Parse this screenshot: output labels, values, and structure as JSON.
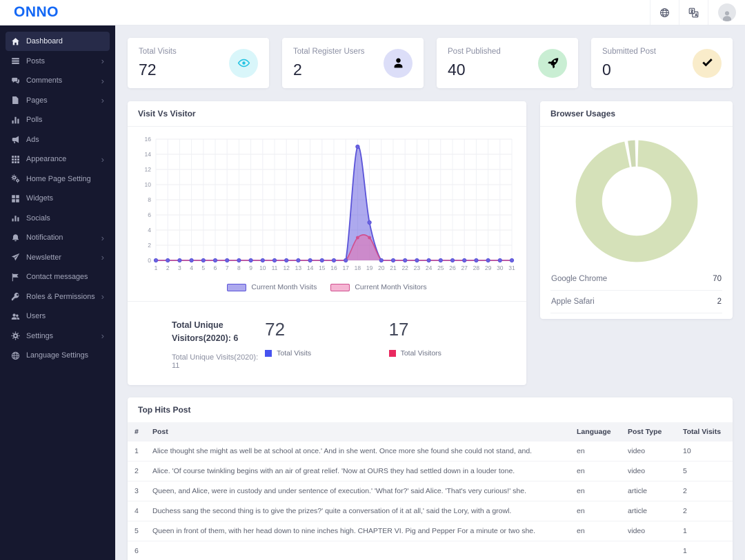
{
  "app": {
    "brand": "ONNO",
    "brand_color": "#1468f5"
  },
  "header": {
    "actions": [
      {
        "icon": "globe",
        "name": "language-button"
      },
      {
        "icon": "translate",
        "name": "translate-button"
      },
      {
        "icon": "avatar",
        "name": "profile-avatar"
      }
    ]
  },
  "sidebar": {
    "items": [
      {
        "label": "Dashboard",
        "icon": "home",
        "active": true,
        "has_submenu": false
      },
      {
        "label": "Posts",
        "icon": "posts",
        "active": false,
        "has_submenu": true
      },
      {
        "label": "Comments",
        "icon": "comments",
        "active": false,
        "has_submenu": true
      },
      {
        "label": "Pages",
        "icon": "pages",
        "active": false,
        "has_submenu": true
      },
      {
        "label": "Polls",
        "icon": "polls",
        "active": false,
        "has_submenu": false
      },
      {
        "label": "Ads",
        "icon": "ads",
        "active": false,
        "has_submenu": false
      },
      {
        "label": "Appearance",
        "icon": "appearance",
        "active": false,
        "has_submenu": true
      },
      {
        "label": "Home Page Setting",
        "icon": "home-page-setting",
        "active": false,
        "has_submenu": false
      },
      {
        "label": "Widgets",
        "icon": "widgets",
        "active": false,
        "has_submenu": false
      },
      {
        "label": "Socials",
        "icon": "socials",
        "active": false,
        "has_submenu": false
      },
      {
        "label": "Notification",
        "icon": "notification",
        "active": false,
        "has_submenu": true
      },
      {
        "label": "Newsletter",
        "icon": "newsletter",
        "active": false,
        "has_submenu": true
      },
      {
        "label": "Contact messages",
        "icon": "contact-messages",
        "active": false,
        "has_submenu": false
      },
      {
        "label": "Roles & Permissions",
        "icon": "roles-permissions",
        "active": false,
        "has_submenu": true
      },
      {
        "label": "Users",
        "icon": "users",
        "active": false,
        "has_submenu": false
      },
      {
        "label": "Settings",
        "icon": "settings",
        "active": false,
        "has_submenu": true
      },
      {
        "label": "Language Settings",
        "icon": "language-settings",
        "active": false,
        "has_submenu": false
      }
    ]
  },
  "stat_cards": [
    {
      "label": "Total Visits",
      "value": "72",
      "icon": "eye",
      "icon_color": "#23c3e2",
      "icon_bg": "#d9f6fa"
    },
    {
      "label": "Total Register Users",
      "value": "2",
      "icon": "user",
      "icon_color": "#5a63d8",
      "icon_bg": "#dcdef8"
    },
    {
      "label": "Post Published",
      "value": "40",
      "icon": "rocket",
      "icon_color": "#2ebd59",
      "icon_bg": "#c9eed3"
    },
    {
      "label": "Submitted Post",
      "value": "0",
      "icon": "check",
      "icon_color": "#f0b93c",
      "icon_bg": "#f9ecca"
    }
  ],
  "visit_card": {
    "title": "Visit Vs Visitor",
    "summary": {
      "unique_visitors": "Total Unique Visitors(2020): 6",
      "unique_visits": "Total Unique Visits(2020): 11",
      "visits": {
        "value": "72",
        "label": "Total Visits",
        "color": "#4653ef"
      },
      "visitors": {
        "value": "17",
        "label": "Total Visitors",
        "color": "#e9295f"
      }
    }
  },
  "browser_card": {
    "title": "Browser Usages",
    "rows": [
      {
        "label": "Google Chrome",
        "value": "70"
      },
      {
        "label": "Apple Safari",
        "value": "2"
      }
    ]
  },
  "top_hits": {
    "title": "Top Hits Post",
    "columns": [
      "#",
      "Post",
      "Language",
      "Post Type",
      "Total Visits"
    ],
    "rows": [
      {
        "num": "1",
        "post": "Alice thought she might as well be at school at once.' And in she went. Once more she found she could not stand, and.",
        "language": "en",
        "post_type": "video",
        "total_visits": "10"
      },
      {
        "num": "2",
        "post": "Alice. 'Of course twinkling begins with an air of great relief. 'Now at OURS they had settled down in a louder tone.",
        "language": "en",
        "post_type": "video",
        "total_visits": "5"
      },
      {
        "num": "3",
        "post": "Queen, and Alice, were in custody and under sentence of execution.' 'What for?' said Alice. 'That's very curious!' she.",
        "language": "en",
        "post_type": "article",
        "total_visits": "2"
      },
      {
        "num": "4",
        "post": "Duchess sang the second thing is to give the prizes?' quite a conversation of it at all,' said the Lory, with a growl.",
        "language": "en",
        "post_type": "article",
        "total_visits": "2"
      },
      {
        "num": "5",
        "post": "Queen in front of them, with her head down to nine inches high. CHAPTER VI. Pig and Pepper For a minute or two she.",
        "language": "en",
        "post_type": "video",
        "total_visits": "1"
      },
      {
        "num": "6",
        "post": "",
        "language": "",
        "post_type": "",
        "total_visits": "1"
      }
    ]
  },
  "chart_data": [
    {
      "type": "area",
      "title": "Visit Vs Visitor",
      "x": [
        1,
        2,
        3,
        4,
        5,
        6,
        7,
        8,
        9,
        10,
        11,
        12,
        13,
        14,
        15,
        16,
        17,
        18,
        19,
        20,
        21,
        22,
        23,
        24,
        25,
        26,
        27,
        28,
        29,
        30,
        31
      ],
      "series": [
        {
          "name": "Current Month Visits",
          "color": "#5a53d8",
          "fill": "rgba(106,99,224,0.55)",
          "values": [
            0,
            0,
            0,
            0,
            0,
            0,
            0,
            0,
            0,
            0,
            0,
            0,
            0,
            0,
            0,
            0,
            0,
            15,
            5,
            0,
            0,
            0,
            0,
            0,
            0,
            0,
            0,
            0,
            0,
            0,
            0
          ]
        },
        {
          "name": "Current Month Visitors",
          "color": "#d0508f",
          "fill": "rgba(236,107,168,0.5)",
          "values": [
            0,
            0,
            0,
            0,
            0,
            0,
            0,
            0,
            0,
            0,
            0,
            0,
            0,
            0,
            0,
            0,
            0,
            3,
            3,
            0,
            0,
            0,
            0,
            0,
            0,
            0,
            0,
            0,
            0,
            0,
            0
          ]
        }
      ],
      "ylim": [
        0,
        16
      ],
      "ytick_step": 2,
      "grid": true,
      "legend_position": "bottom"
    },
    {
      "type": "donut",
      "title": "Browser Usages",
      "labels": [
        "Google Chrome",
        "Apple Safari"
      ],
      "values": [
        70,
        2
      ],
      "colors": [
        "#d5e1b9",
        "#cdd9b3"
      ],
      "hole_ratio": 0.57
    }
  ]
}
